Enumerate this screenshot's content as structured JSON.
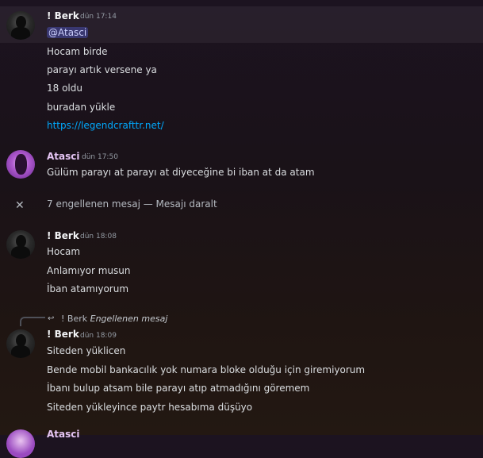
{
  "messages": [
    {
      "author": "! Berk",
      "time": "dün 17:14",
      "lines": [
        "@Atasci",
        "Hocam birde",
        "parayı artık versene ya",
        "18 oldu",
        "buradan yükle",
        "https://legendcrafttr.net/"
      ]
    },
    {
      "author": "Atasci",
      "time": "dün 17:50",
      "lines": [
        "Gülüm parayı at parayı at diyeceğine bi iban at da atam"
      ]
    },
    {
      "author": "! Berk",
      "time": "dün 18:08",
      "lines": [
        "Hocam",
        "Anlamıyor musun",
        "İban atamıyorum"
      ]
    },
    {
      "author": "! Berk",
      "time": "dün 18:09",
      "reply": {
        "author": "! Berk",
        "text": "Engellenen mesaj"
      },
      "lines": [
        "Siteden yüklicen",
        "Bende mobil bankacılık yok numara bloke olduğu için giremiyorum",
        "İbanı bulup atsam bile parayı atıp atmadığını göremem",
        "Siteden yükleyince paytr hesabıma düşüyo"
      ]
    }
  ],
  "blocked": {
    "text": "7 engellenen mesaj — Mesajı daralt",
    "close_glyph": "✕"
  },
  "next_author": "Atasci",
  "icons": {
    "reply_arrow": "reply-arrow-icon",
    "close": "close-icon"
  },
  "colors": {
    "link": "#00a8fc",
    "mention_bg": "#5865f2",
    "atasci_name": "#e6c6f5"
  }
}
